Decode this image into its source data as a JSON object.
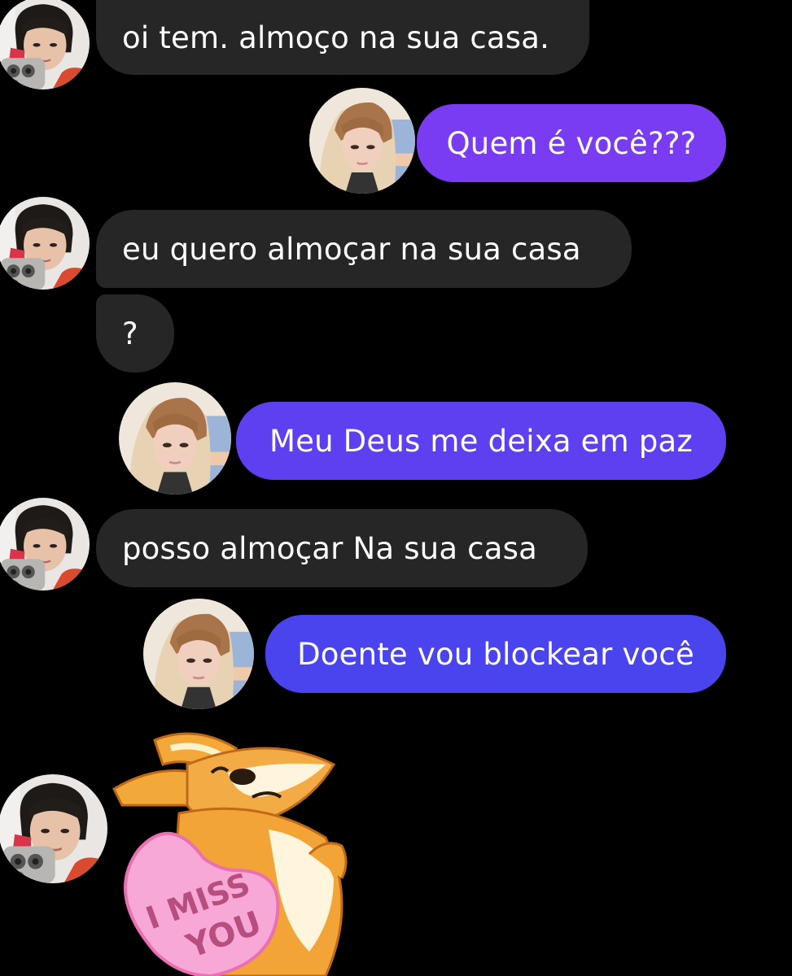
{
  "chat": {
    "messages": [
      {
        "sender": "other",
        "text": "oi tem. almoço na sua casa."
      },
      {
        "sender": "me",
        "text": "Quem é você???"
      },
      {
        "sender": "other",
        "text": "eu quero almoçar  na sua casa"
      },
      {
        "sender": "other",
        "text": "?"
      },
      {
        "sender": "me",
        "text": "Meu Deus me deixa em paz"
      },
      {
        "sender": "other",
        "text": "posso almoçar Na sua casa"
      },
      {
        "sender": "me",
        "text": "Doente vou blockear você"
      }
    ],
    "sticker": {
      "text_line1": "I MISS",
      "text_line2": "YOU"
    }
  },
  "colors": {
    "background": "#000000",
    "incoming_bubble": "#262626",
    "outgoing_bubble_top": "#7a3cf2",
    "outgoing_bubble_bottom": "#4a44ee"
  },
  "icons": [
    "avatar-other-icon",
    "avatar-me-icon",
    "corgi-sticker-icon"
  ]
}
